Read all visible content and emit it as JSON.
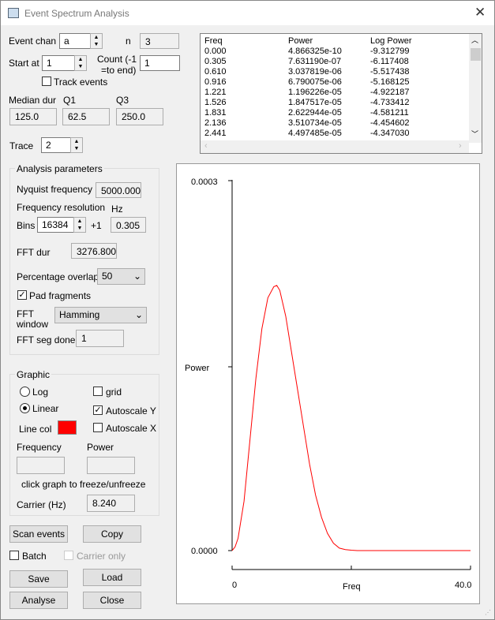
{
  "window": {
    "title": "Event Spectrum Analysis"
  },
  "event": {
    "chan_label": "Event chan",
    "chan_value": "a",
    "n_label": "n",
    "n_value": "3",
    "start_label": "Start at",
    "start_value": "1",
    "count_label1": "Count (-1",
    "count_label2": "=to end)",
    "count_value": "1",
    "track_label": "Track events",
    "median_label": "Median dur",
    "q1_label": "Q1",
    "q3_label": "Q3",
    "median_value": "125.0",
    "q1_value": "62.5",
    "q3_value": "250.0",
    "trace_label": "Trace",
    "trace_value": "2"
  },
  "table": {
    "headers": [
      "Freq",
      "Power",
      "Log Power"
    ],
    "rows": [
      [
        "0.000",
        "4.866325e-10",
        "-9.312799"
      ],
      [
        "0.305",
        "7.631190e-07",
        "-6.117408"
      ],
      [
        "0.610",
        "3.037819e-06",
        "-5.517438"
      ],
      [
        "0.916",
        "6.790075e-06",
        "-5.168125"
      ],
      [
        "1.221",
        "1.196226e-05",
        "-4.922187"
      ],
      [
        "1.526",
        "1.847517e-05",
        "-4.733412"
      ],
      [
        "1.831",
        "2.622944e-05",
        "-4.581211"
      ],
      [
        "2.136",
        "3.510734e-05",
        "-4.454602"
      ],
      [
        "2.441",
        "4.497485e-05",
        "-4.347030"
      ]
    ]
  },
  "analysis": {
    "group_label": "Analysis parameters",
    "nyquist_label": "Nyquist frequency",
    "nyquist_value": "5000.000",
    "freq_res_label": "Frequency resolution",
    "hz_label": "Hz",
    "bins_label": "Bins",
    "bins_value": "16384",
    "plus_one": "+1",
    "res_value": "0.305",
    "fft_dur_label": "FFT dur",
    "fft_dur_value": "3276.800",
    "overlap_label": "Percentage overlap",
    "overlap_value": "50",
    "pad_label": "Pad fragments",
    "window_label1": "FFT",
    "window_label2": "window",
    "window_value": "Hamming",
    "seg_done_label": "FFT seg done",
    "seg_done_value": "1"
  },
  "graphic": {
    "group_label": "Graphic",
    "log_label": "Log",
    "linear_label": "Linear",
    "grid_label": "grid",
    "autoy_label": "Autoscale Y",
    "autox_label": "Autoscale X",
    "linecol_label": "Line col",
    "line_color": "#ff0000",
    "freq_label": "Frequency",
    "power_label": "Power",
    "hint": "click graph to freeze/unfreeze",
    "carrier_label": "Carrier (Hz)",
    "carrier_value": "8.240"
  },
  "buttons": {
    "scan": "Scan events",
    "copy": "Copy",
    "batch": "Batch",
    "carrier_only": "Carrier only",
    "save": "Save",
    "load": "Load",
    "analyse": "Analyse",
    "close": "Close"
  },
  "chart_data": {
    "type": "line",
    "xlabel": "Freq",
    "ylabel": "Power",
    "xlim": [
      0,
      40
    ],
    "ylim": [
      0,
      0.0003
    ],
    "xtick_labels": [
      "0",
      "40.0"
    ],
    "ytick_labels": [
      "0.0000",
      "0.0003"
    ],
    "color": "#ff0000",
    "x": [
      0,
      0.5,
      1,
      2,
      3,
      4,
      5,
      6,
      7,
      7.5,
      8,
      9,
      10,
      11,
      12,
      13,
      14,
      15,
      16,
      17,
      18,
      19,
      20,
      21,
      25,
      30,
      35,
      40
    ],
    "y": [
      0,
      3e-06,
      1e-05,
      4e-05,
      9e-05,
      0.00014,
      0.00018,
      0.000205,
      0.000214,
      0.000215,
      0.000211,
      0.00019,
      0.00016,
      0.00013,
      0.0001,
      7e-05,
      4.5e-05,
      2.7e-05,
      1.4e-05,
      6e-06,
      2e-06,
      8e-07,
      3e-07,
      0,
      0,
      0,
      0,
      0
    ]
  }
}
